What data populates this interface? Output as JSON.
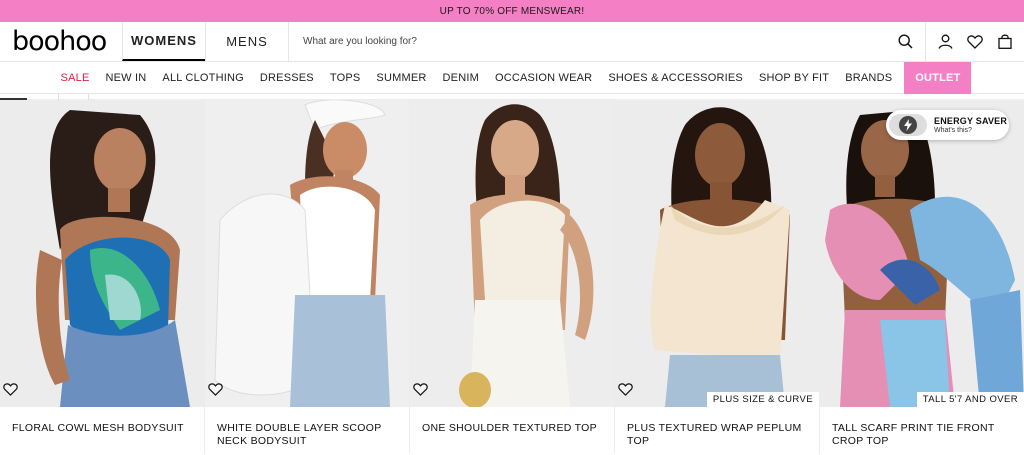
{
  "promo": {
    "text": "UP TO 70% OFF MENSWEAR!",
    "background": "#f57fc4"
  },
  "header": {
    "logo": "boohoo",
    "tabs": [
      {
        "label": "WOMENS",
        "active": true
      },
      {
        "label": "MENS",
        "active": false
      }
    ],
    "search": {
      "placeholder": "What are you looking for?",
      "value": ""
    },
    "icons": [
      "search-icon",
      "account-icon",
      "wishlist-icon",
      "bag-icon"
    ]
  },
  "nav": {
    "items": [
      {
        "label": "SALE",
        "highlight": "sale"
      },
      {
        "label": "NEW IN"
      },
      {
        "label": "ALL CLOTHING"
      },
      {
        "label": "DRESSES"
      },
      {
        "label": "TOPS"
      },
      {
        "label": "SUMMER"
      },
      {
        "label": "DENIM"
      },
      {
        "label": "OCCASION WEAR"
      },
      {
        "label": "SHOES & ACCESSORIES"
      },
      {
        "label": "SHOP BY FIT"
      },
      {
        "label": "BRANDS"
      },
      {
        "label": "OUTLET",
        "highlight": "outlet"
      }
    ],
    "sale_color": "#e0213c",
    "outlet_color": "#f57fc4"
  },
  "products": [
    {
      "title": "FLORAL COWL MESH BODYSUIT",
      "badge": ""
    },
    {
      "title": "WHITE DOUBLE LAYER SCOOP NECK BODYSUIT",
      "badge": ""
    },
    {
      "title": "ONE SHOULDER TEXTURED TOP",
      "badge": ""
    },
    {
      "title": "PLUS TEXTURED WRAP PEPLUM TOP",
      "badge": "PLUS SIZE & CURVE"
    },
    {
      "title": "TALL SCARF PRINT TIE FRONT CROP TOP",
      "badge": "TALL 5'7 AND OVER"
    }
  ],
  "energy_saver": {
    "label": "ENERGY SAVER",
    "sublabel": "What's this?"
  }
}
